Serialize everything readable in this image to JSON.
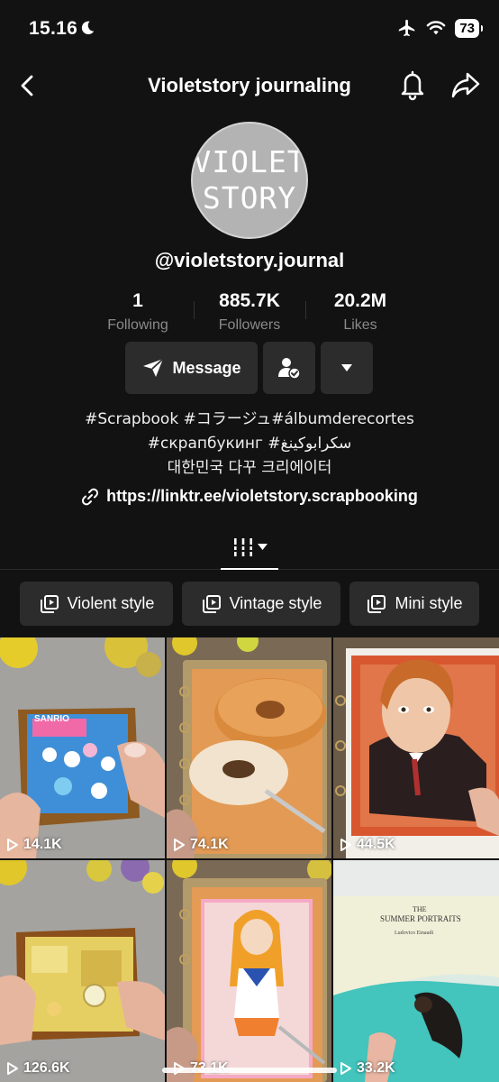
{
  "status": {
    "time": "15.16",
    "battery": "73"
  },
  "header": {
    "title": "Violetstory journaling"
  },
  "profile": {
    "avatar_line1": "VIOLET",
    "avatar_line2": "STORY",
    "username": "@violetstory.journal",
    "stats": [
      {
        "value": "1",
        "label": "Following"
      },
      {
        "value": "885.7K",
        "label": "Followers"
      },
      {
        "value": "20.2M",
        "label": "Likes"
      }
    ],
    "message_label": "Message",
    "bio_line1": "#Scrapbook #コラージュ#álbumderecortes",
    "bio_line2": "#скрапбукинг #سكرابوكينغ",
    "bio_line3": "대한민국 다꾸 크리에이터",
    "link": "https://linktr.ee/violetstory.scrapbooking"
  },
  "playlists": [
    {
      "label": "Violent style"
    },
    {
      "label": "Vintage style"
    },
    {
      "label": "Mini style"
    }
  ],
  "videos": [
    {
      "views": "14.1K"
    },
    {
      "views": "74.1K"
    },
    {
      "views": "44.5K"
    },
    {
      "views": "126.6K"
    },
    {
      "views": "73.1K"
    },
    {
      "views": "33.2K"
    }
  ],
  "tile_texts": {
    "sanrio": "SANRIO",
    "album_title_1": "THE",
    "album_title_2": "SUMMER PORTRAITS",
    "album_artist": "Ludovico Einaudi"
  }
}
